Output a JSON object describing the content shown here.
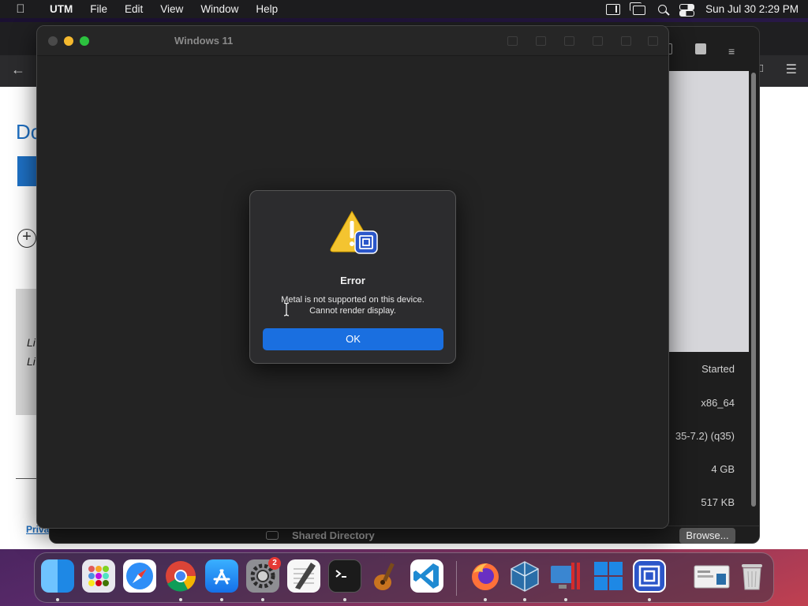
{
  "menubar": {
    "app_name": "UTM",
    "menus": [
      "File",
      "Edit",
      "View",
      "Window",
      "Help"
    ],
    "clock": "Sun Jul 30  2:29 PM"
  },
  "background_browser": {
    "doc_title_partial": "Do",
    "li_line_1": "Li",
    "li_line_2": "Li",
    "privacy_link": "Priva"
  },
  "utm_window": {
    "status_rows": [
      {
        "value": "Started"
      },
      {
        "value": "x86_64"
      },
      {
        "value": "35-7.2) (q35)"
      },
      {
        "value": "4 GB"
      },
      {
        "value": "517 KB"
      }
    ],
    "shared_directory_label": "Shared Directory",
    "browse_button": "Browse..."
  },
  "vm_window": {
    "title": "Windows 11"
  },
  "dialog": {
    "title": "Error",
    "message_line_1": "Metal is not supported on this device.",
    "message_line_2": "Cannot render display.",
    "ok_label": "OK",
    "icon": "warning-icon"
  },
  "dock": {
    "items": [
      "finder",
      "launchpad",
      "safari",
      "chrome",
      "app-store",
      "system-settings",
      "textedit",
      "terminal",
      "instruments",
      "vscode",
      "firefox",
      "virtualbox",
      "parallels",
      "windows-app",
      "utm",
      "preview-window",
      "trash"
    ],
    "system_settings_badge": "2"
  }
}
